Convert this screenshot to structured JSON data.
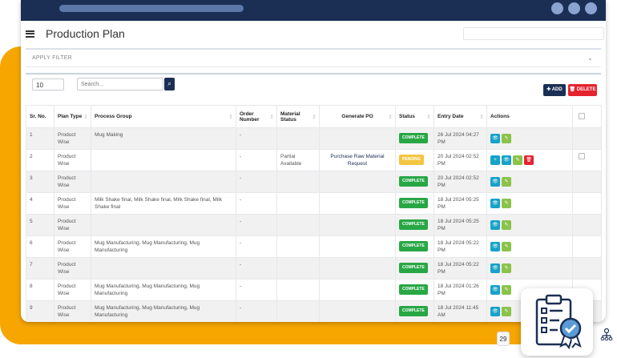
{
  "page": {
    "title": "Production Plan"
  },
  "filter": {
    "label": "APPLY FILTER"
  },
  "controls": {
    "page_length": "10",
    "search_placeholder": "Search...",
    "add_label": "✚ ADD",
    "delete_label": "🗑 DELETE"
  },
  "table": {
    "headers": [
      "Sr. No.",
      "Plan Type",
      "Process Group",
      "Order Number",
      "Material Status",
      "Generate PO",
      "Status",
      "Entry Date",
      "Actions",
      ""
    ],
    "rows": [
      {
        "sr": "1",
        "plan": "Product Wise",
        "group": "Mug Making",
        "order": "-",
        "material": "",
        "po": "",
        "status": "COMPLETE",
        "date": "26 Jul 2024 04:27 PM"
      },
      {
        "sr": "2",
        "plan": "Product Wise",
        "group": "",
        "order": "-",
        "material": "Partial Available",
        "po": "Purchase Raw Material Request",
        "status": "PENDING",
        "date": "20 Jul 2024 02:52 PM"
      },
      {
        "sr": "3",
        "plan": "Product Wise",
        "group": "",
        "order": "-",
        "material": "",
        "po": "",
        "status": "COMPLETE",
        "date": "20 Jul 2024 02:52 PM"
      },
      {
        "sr": "4",
        "plan": "Product Wise",
        "group": "Milk Shake final, Milk Shake final, Milk Shake final, Milk Shake final",
        "order": "-",
        "material": "",
        "po": "",
        "status": "COMPLETE",
        "date": "18 Jul 2024 05:25 PM"
      },
      {
        "sr": "5",
        "plan": "Product Wise",
        "group": "",
        "order": "-",
        "material": "",
        "po": "",
        "status": "COMPLETE",
        "date": "18 Jul 2024 05:25 PM"
      },
      {
        "sr": "6",
        "plan": "Product Wise",
        "group": "Mug Manufacturing, Mug Manufacturing, Mug Manufacturing",
        "order": "-",
        "material": "",
        "po": "",
        "status": "COMPLETE",
        "date": "18 Jul 2024 05:22 PM"
      },
      {
        "sr": "7",
        "plan": "Product Wise",
        "group": "",
        "order": "-",
        "material": "",
        "po": "",
        "status": "COMPLETE",
        "date": "18 Jul 2024 05:22 PM"
      },
      {
        "sr": "8",
        "plan": "Product Wise",
        "group": "Mug Manufacturing, Mug Manufacturing, Mug Manufacturing",
        "order": "-",
        "material": "",
        "po": "",
        "status": "COMPLETE",
        "date": "18 Jul 2024 01:26 PM"
      },
      {
        "sr": "9",
        "plan": "Product Wise",
        "group": "Mug Manufacturing, Mug Manufacturing, Mug Manufacturing",
        "order": "-",
        "material": "",
        "po": "",
        "status": "COMPLETE",
        "date": "18 Jul 2024 11:45 AM"
      }
    ]
  },
  "widgets": {
    "mini_badge": "29"
  },
  "colors": {
    "navy": "#1b2f55",
    "accent_orange": "#f7a600",
    "complete": "#28a745",
    "pending": "#f4c542",
    "danger": "#e5232e"
  }
}
